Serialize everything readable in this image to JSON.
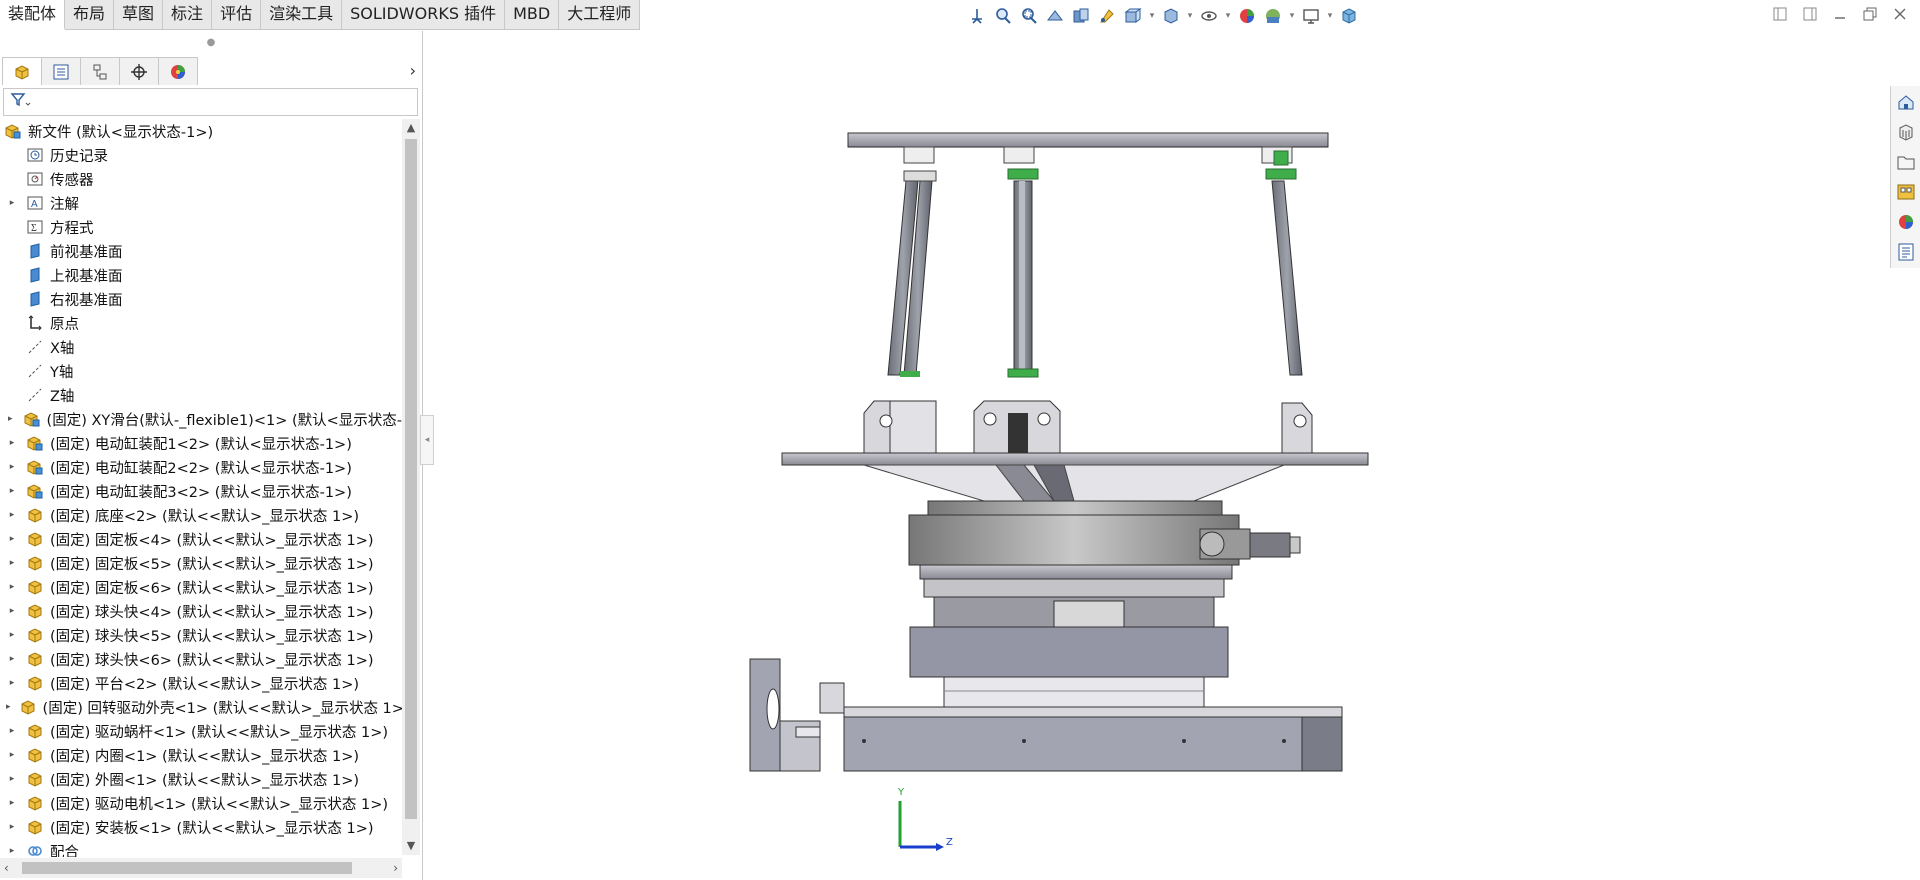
{
  "tabs": [
    {
      "label": "装配体",
      "active": true
    },
    {
      "label": "布局"
    },
    {
      "label": "草图"
    },
    {
      "label": "标注"
    },
    {
      "label": "评估"
    },
    {
      "label": "渲染工具"
    },
    {
      "label": "SOLIDWORKS 插件"
    },
    {
      "label": "MBD"
    },
    {
      "label": "大工程师"
    }
  ],
  "view_toolbar": [
    "standard-views-icon",
    "zoom-to-fit-icon",
    "zoom-area-icon",
    "previous-view-icon",
    "section-view-icon",
    "dynamic-annotation-icon",
    "view-orientation-icon",
    "display-style-icon",
    "hide-show-icon",
    "edit-appearance-icon",
    "apply-scene-icon",
    "view-settings-icon",
    "cube-icon"
  ],
  "tree": {
    "root": "新文件  (默认<显示状态-1>)",
    "items": [
      {
        "label": "历史记录",
        "icon": "history-icon",
        "twisty": false
      },
      {
        "label": "传感器",
        "icon": "sensor-icon",
        "twisty": false
      },
      {
        "label": "注解",
        "icon": "annotation-icon",
        "twisty": true
      },
      {
        "label": "方程式",
        "icon": "equation-icon",
        "twisty": false
      },
      {
        "label": "前视基准面",
        "icon": "plane-icon",
        "twisty": false
      },
      {
        "label": "上视基准面",
        "icon": "plane-icon",
        "twisty": false
      },
      {
        "label": "右视基准面",
        "icon": "plane-icon",
        "twisty": false
      },
      {
        "label": "原点",
        "icon": "origin-icon",
        "twisty": false
      },
      {
        "label": "X轴",
        "icon": "axis-icon",
        "twisty": false
      },
      {
        "label": "Y轴",
        "icon": "axis-icon",
        "twisty": false
      },
      {
        "label": "Z轴",
        "icon": "axis-icon",
        "twisty": false
      },
      {
        "label": "(固定) XY滑台(默认-_flexible1)<1> (默认<显示状态-",
        "icon": "subassembly-icon",
        "twisty": true
      },
      {
        "label": "(固定) 电动缸装配1<2> (默认<显示状态-1>)",
        "icon": "subassembly-icon",
        "twisty": true
      },
      {
        "label": "(固定) 电动缸装配2<2> (默认<显示状态-1>)",
        "icon": "subassembly-icon",
        "twisty": true
      },
      {
        "label": "(固定) 电动缸装配3<2> (默认<显示状态-1>)",
        "icon": "subassembly-icon",
        "twisty": true
      },
      {
        "label": "(固定) 底座<2> (默认<<默认>_显示状态 1>)",
        "icon": "part-icon",
        "twisty": true
      },
      {
        "label": "(固定) 固定板<4> (默认<<默认>_显示状态 1>)",
        "icon": "part-icon",
        "twisty": true
      },
      {
        "label": "(固定) 固定板<5> (默认<<默认>_显示状态 1>)",
        "icon": "part-icon",
        "twisty": true
      },
      {
        "label": "(固定) 固定板<6> (默认<<默认>_显示状态 1>)",
        "icon": "part-icon",
        "twisty": true
      },
      {
        "label": "(固定) 球头快<4> (默认<<默认>_显示状态 1>)",
        "icon": "part-icon",
        "twisty": true
      },
      {
        "label": "(固定) 球头快<5> (默认<<默认>_显示状态 1>)",
        "icon": "part-icon",
        "twisty": true
      },
      {
        "label": "(固定) 球头快<6> (默认<<默认>_显示状态 1>)",
        "icon": "part-icon",
        "twisty": true
      },
      {
        "label": "(固定) 平台<2> (默认<<默认>_显示状态 1>)",
        "icon": "part-icon",
        "twisty": true
      },
      {
        "label": "(固定) 回转驱动外壳<1> (默认<<默认>_显示状态 1>",
        "icon": "part-icon",
        "twisty": true
      },
      {
        "label": "(固定) 驱动蜗杆<1> (默认<<默认>_显示状态 1>)",
        "icon": "part-icon",
        "twisty": true
      },
      {
        "label": "(固定) 内圈<1> (默认<<默认>_显示状态 1>)",
        "icon": "part-icon",
        "twisty": true
      },
      {
        "label": "(固定) 外圈<1> (默认<<默认>_显示状态 1>)",
        "icon": "part-icon",
        "twisty": true
      },
      {
        "label": "(固定) 驱动电机<1> (默认<<默认>_显示状态 1>)",
        "icon": "part-icon",
        "twisty": true
      },
      {
        "label": "(固定) 安装板<1> (默认<<默认>_显示状态 1>)",
        "icon": "part-icon",
        "twisty": true
      },
      {
        "label": "配合",
        "icon": "mates-icon",
        "twisty": true
      }
    ]
  },
  "triad": {
    "y": "Y",
    "z": "Z"
  },
  "task_pane": [
    "home-icon",
    "design-library-icon",
    "file-explorer-icon",
    "view-palette-icon",
    "appearances-icon",
    "custom-properties-icon"
  ]
}
